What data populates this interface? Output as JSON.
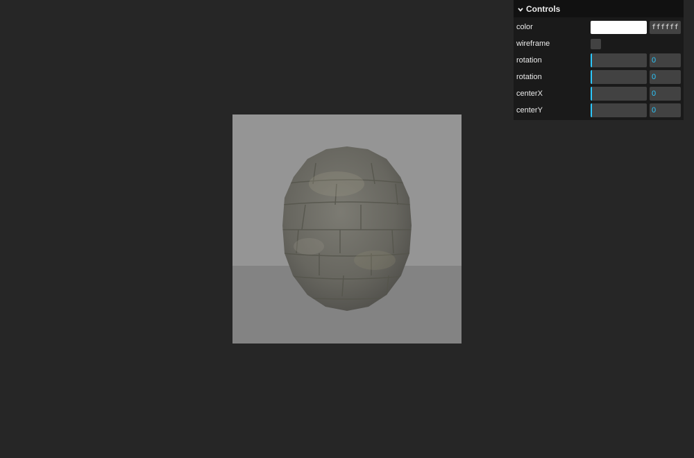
{
  "panel": {
    "title": "Controls",
    "color": {
      "label": "color",
      "value": "ffffff",
      "swatch": "#ffffff"
    },
    "wireframe": {
      "label": "wireframe",
      "checked": false
    },
    "sliders": [
      {
        "label": "rotation",
        "value": "0",
        "level": 0
      },
      {
        "label": "rotation",
        "value": "0",
        "level": 0
      },
      {
        "label": "centerX",
        "value": "0",
        "level": 0
      },
      {
        "label": "centerY",
        "value": "0",
        "level": 0
      }
    ]
  },
  "colors": {
    "background": "#262626",
    "accent": "#2cc9ff",
    "scene_background": "#959595",
    "scene_floor": "#838383",
    "sphere": "#6f6f68"
  },
  "icons": {
    "panel_toggle": "chevron-down-icon"
  }
}
